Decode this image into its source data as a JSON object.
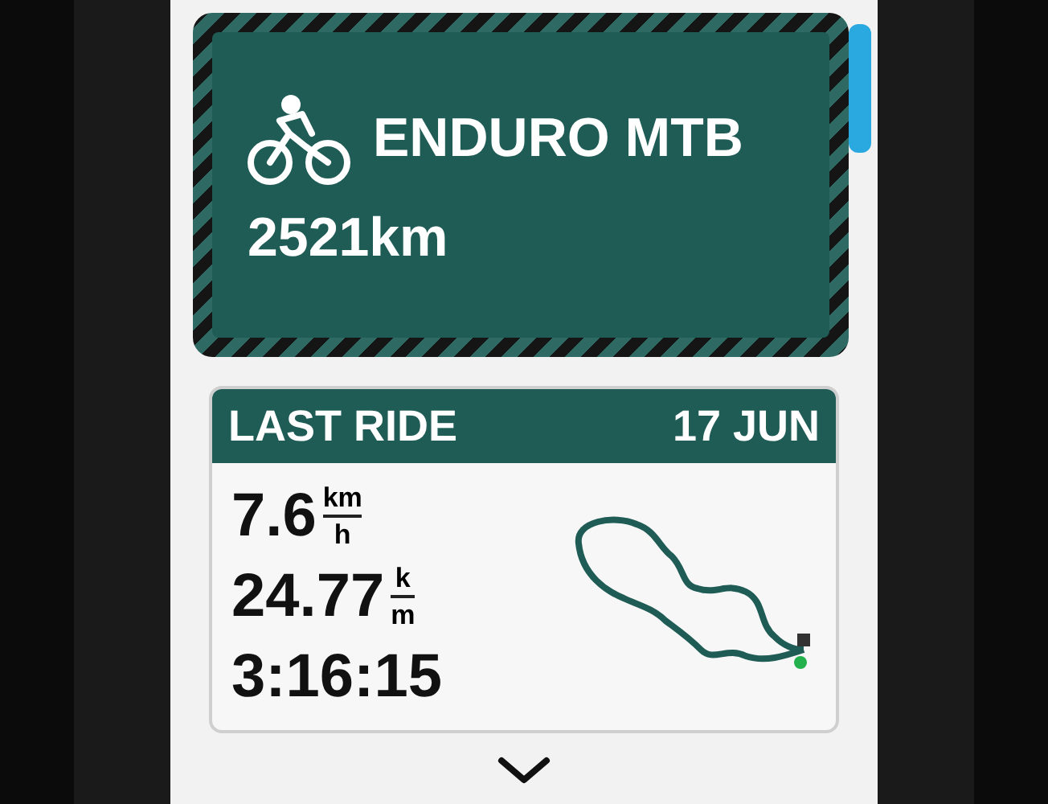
{
  "profile_card": {
    "name": "ENDURO MTB",
    "distance": "2521km"
  },
  "last_ride": {
    "title": "LAST RIDE",
    "date": "17 JUN",
    "stats": [
      {
        "value": "7.6",
        "unit_top": "km",
        "unit_bottom": "h"
      },
      {
        "value": "24.77",
        "unit_top": "k",
        "unit_bottom": "m"
      },
      {
        "value": "3:16:15"
      }
    ]
  }
}
